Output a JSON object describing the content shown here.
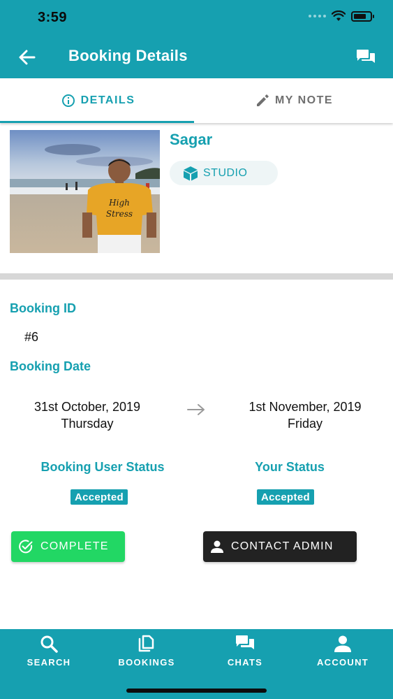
{
  "status_bar": {
    "time": "3:59"
  },
  "app_bar": {
    "title": "Booking Details",
    "back_icon": "arrow-left-icon",
    "action_icon": "chat-bubbles-icon"
  },
  "tabs": [
    {
      "label": "DETAILS",
      "icon": "info-icon",
      "active": true
    },
    {
      "label": "MY NOTE",
      "icon": "pencil-icon",
      "active": false
    }
  ],
  "profile": {
    "name": "Sagar",
    "type_label": "STUDIO",
    "type_icon": "cube-icon",
    "photo_shirt_text": "High Stress"
  },
  "booking": {
    "id_label": "Booking ID",
    "id_value": "#6",
    "date_label": "Booking Date",
    "start_date": "31st October, 2019",
    "start_day": "Thursday",
    "end_date": "1st November, 2019",
    "end_day": "Friday"
  },
  "statuses": {
    "user_status_label": "Booking User Status",
    "user_status_value": "Accepted",
    "your_status_label": "Your Status",
    "your_status_value": "Accepted"
  },
  "actions": {
    "complete_label": "COMPLETE",
    "contact_label": "CONTACT ADMIN"
  },
  "bottom_nav": [
    {
      "label": "SEARCH",
      "icon": "search-icon"
    },
    {
      "label": "BOOKINGS",
      "icon": "documents-icon"
    },
    {
      "label": "CHATS",
      "icon": "chat-bubbles-icon"
    },
    {
      "label": "ACCOUNT",
      "icon": "person-icon"
    }
  ],
  "colors": {
    "primary": "#16a0b0",
    "success": "#22d764",
    "dark_button": "#222222",
    "divider": "#d7d7d7"
  }
}
